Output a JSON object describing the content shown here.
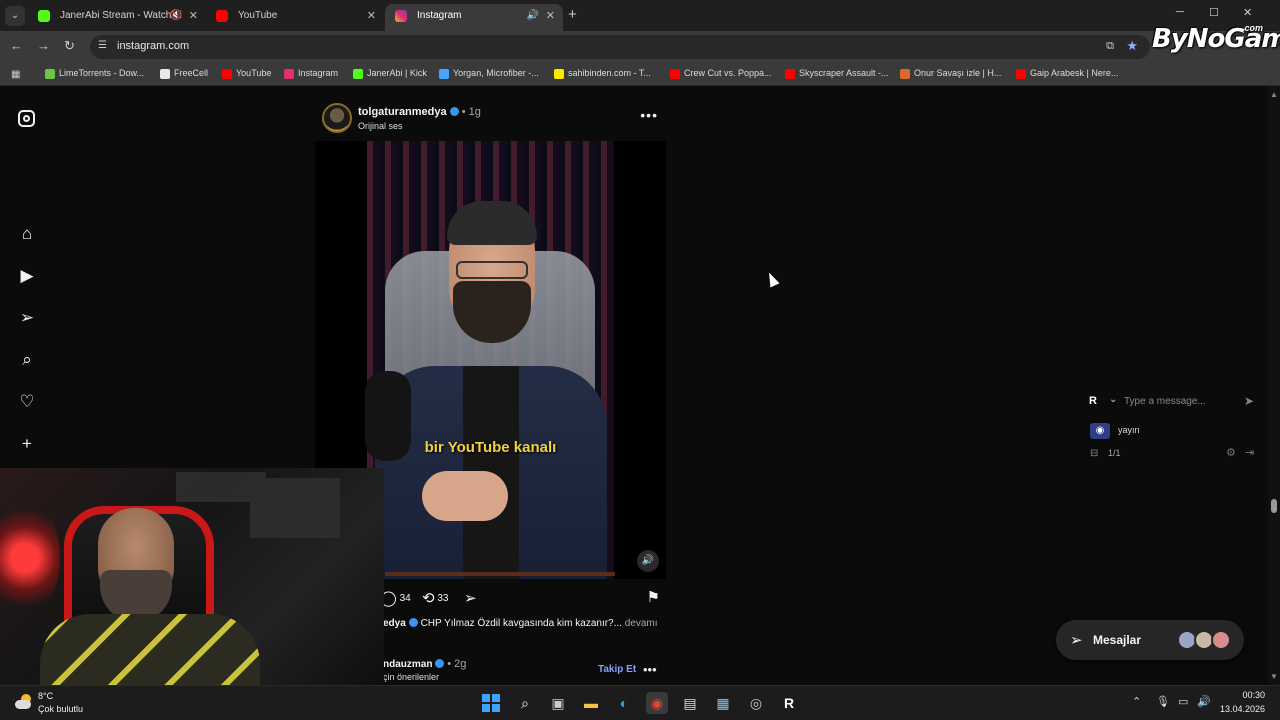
{
  "browser": {
    "tabs": [
      {
        "title": "JanerAbi Stream - Watch Li",
        "favicon_color": "#53fc18",
        "muted": true
      },
      {
        "title": "YouTube",
        "favicon_color": "#ff0000"
      },
      {
        "title": "Instagram",
        "favicon_color": "#e1306c",
        "active": true
      }
    ],
    "url": "instagram.com",
    "bookmarks": [
      {
        "label": "LimeTorrents - Dow...",
        "color": "#6cc644"
      },
      {
        "label": "FreeCell",
        "color": "#e8e8e8"
      },
      {
        "label": "YouTube",
        "color": "#ff0000"
      },
      {
        "label": "Instagram",
        "color": "#e1306c"
      },
      {
        "label": "JanerAbi | Kick",
        "color": "#53fc18"
      },
      {
        "label": "Yorgan, Microfiber -...",
        "color": "#4aa3ff"
      },
      {
        "label": "sahibinden.com - T...",
        "color": "#ffe800"
      },
      {
        "label": "Crew Cut vs. Poppa...",
        "color": "#ff0000"
      },
      {
        "label": "Skyscraper Assault -...",
        "color": "#ff0000"
      },
      {
        "label": "Onur Savaşı izle | H...",
        "color": "#d86a2a"
      },
      {
        "label": "Gaip Arabesk | Nere...",
        "color": "#ff0000"
      }
    ],
    "watermark": "ByNoGame",
    "watermark_sup": ".com"
  },
  "post": {
    "username": "tolgaturanmedya",
    "time": "1g",
    "audio": "Orijinal ses",
    "video_caption": "bir YouTube kanalı",
    "likes": "34",
    "reposts": "33",
    "caption_user": "edya",
    "caption_text": "CHP Yılmaz Özdil kavgasında kim kazanır?...",
    "caption_more": "devamı",
    "next_username": "ndauzman",
    "next_time": "2g",
    "next_sub": "çin önerilenler",
    "follow_label": "Takip Et"
  },
  "chat": {
    "badge": "R",
    "placeholder": "Type a message...",
    "channel": "yayın",
    "count": "1/1"
  },
  "messages": {
    "label": "Mesajlar",
    "avatar_colors": [
      "#9aa6c4",
      "#c9b8a8",
      "#d98a8a"
    ]
  },
  "taskbar": {
    "temperature": "8°C",
    "condition": "Çok bulutlu",
    "time": "00:30",
    "date": "13.04.2026"
  }
}
